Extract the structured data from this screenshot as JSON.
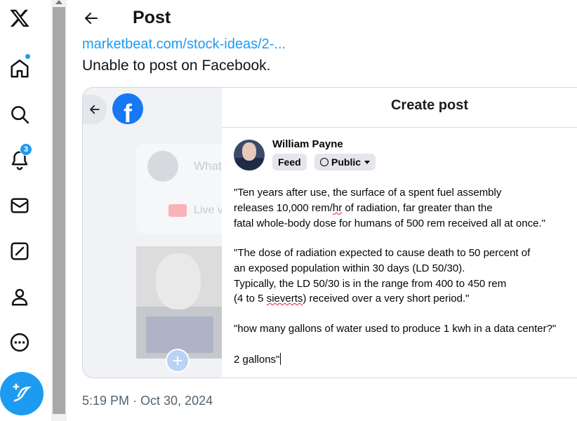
{
  "header": {
    "title": "Post"
  },
  "post": {
    "link_text": "marketbeat.com/stock-ideas/2-...",
    "text": "Unable to post on Facebook.",
    "timestamp": "5:19 PM · Oct 30, 2024"
  },
  "nav": {
    "notifications_badge": "3",
    "icons": [
      "x-logo-icon",
      "home-icon",
      "search-icon",
      "notifications-icon",
      "messages-icon",
      "grok-icon",
      "profile-icon",
      "more-icon",
      "compose-icon"
    ]
  },
  "screenshot": {
    "fb_logo": "f",
    "composer_placeholder": "What",
    "live_label": "Live v",
    "dialog_title": "Create post",
    "author_name": "William Payne",
    "feed_label": "Feed",
    "public_label": "Public",
    "lines": {
      "l1": "\"Ten years after use, the surface of a spent fuel assembly",
      "l2_pre": "releases 10,000 rem/",
      "l2_hr": "hr",
      "l2_post": " of radiation, far greater than the",
      "l3": "fatal whole-body dose for humans of 500 rem received all at once.\"",
      "l4": "\"The dose of radiation expected to cause death to 50 percent of",
      "l5": "an exposed population within 30 days (LD 50/30).",
      "l6": "Typically, the LD 50/30 is in the range from 400 to 450 rem",
      "l7_pre": "(4 to 5 ",
      "l7_sieverts": "sieverts",
      "l7_post": ") received over a very short period.\"",
      "l8": "\"how many gallons of water used to produce 1 kwh in a data center?\"",
      "l9": "2 gallons\""
    }
  },
  "colors": {
    "accent": "#1d9bf0",
    "facebook": "#1877f2",
    "text": "#0f1419",
    "muted": "#536471"
  }
}
